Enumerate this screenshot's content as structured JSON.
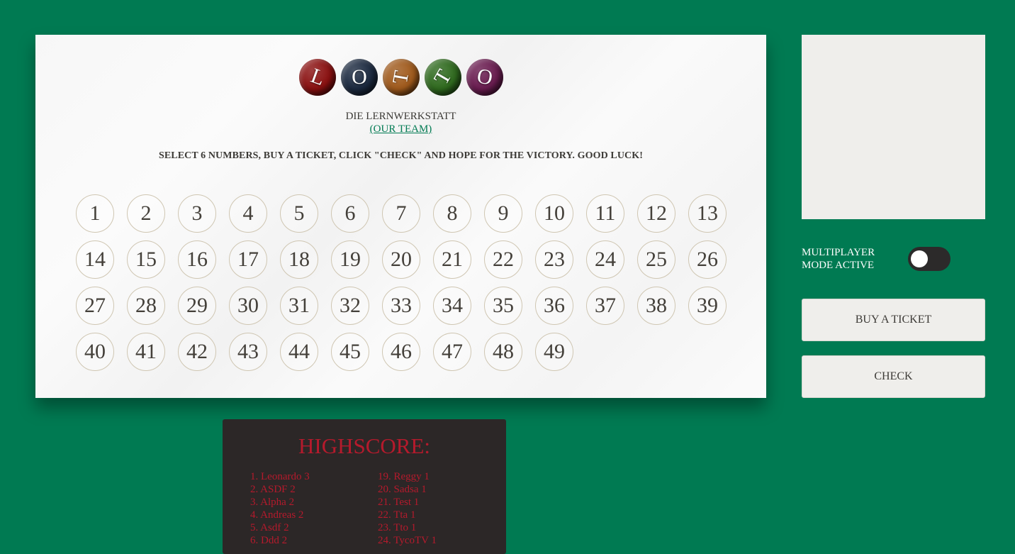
{
  "logo": {
    "letters": [
      {
        "char": "L",
        "color": "#8a1010",
        "rotate": 20
      },
      {
        "char": "O",
        "color": "#1c2a40",
        "rotate": 0
      },
      {
        "char": "T",
        "color": "#a05a1c",
        "rotate": -80
      },
      {
        "char": "T",
        "color": "#2f6a1e",
        "rotate": -60
      },
      {
        "char": "O",
        "color": "#6a1c50",
        "rotate": 10
      }
    ]
  },
  "subtitle": "DIE LERNWERKSTATT",
  "team_link": "(OUR TEAM)",
  "instructions": "SELECT 6 NUMBERS, BUY A TICKET, CLICK \"CHECK\" AND HOPE FOR THE VICTORY. GOOD LUCK!",
  "numbers": [
    1,
    2,
    3,
    4,
    5,
    6,
    7,
    8,
    9,
    10,
    11,
    12,
    13,
    14,
    15,
    16,
    17,
    18,
    19,
    20,
    21,
    22,
    23,
    24,
    25,
    26,
    27,
    28,
    29,
    30,
    31,
    32,
    33,
    34,
    35,
    36,
    37,
    38,
    39,
    40,
    41,
    42,
    43,
    44,
    45,
    46,
    47,
    48,
    49
  ],
  "multiplayer_label": "MULTIPLAYER MODE ACTIVE",
  "multiplayer_active": false,
  "buy_button": "BUY A TICKET",
  "check_button": "CHECK",
  "highscore": {
    "title": "HIGHSCORE:",
    "left": [
      "1. Leonardo 3",
      "2. ASDF 2",
      "3. Alpha 2",
      "4. Andreas 2",
      "5. Asdf 2",
      "6. Ddd 2"
    ],
    "right": [
      "19. Reggy 1",
      "20. Sadsa 1",
      "21. Test 1",
      "22. Tta 1",
      "23. Tto 1",
      "24. TycoTV 1"
    ]
  }
}
